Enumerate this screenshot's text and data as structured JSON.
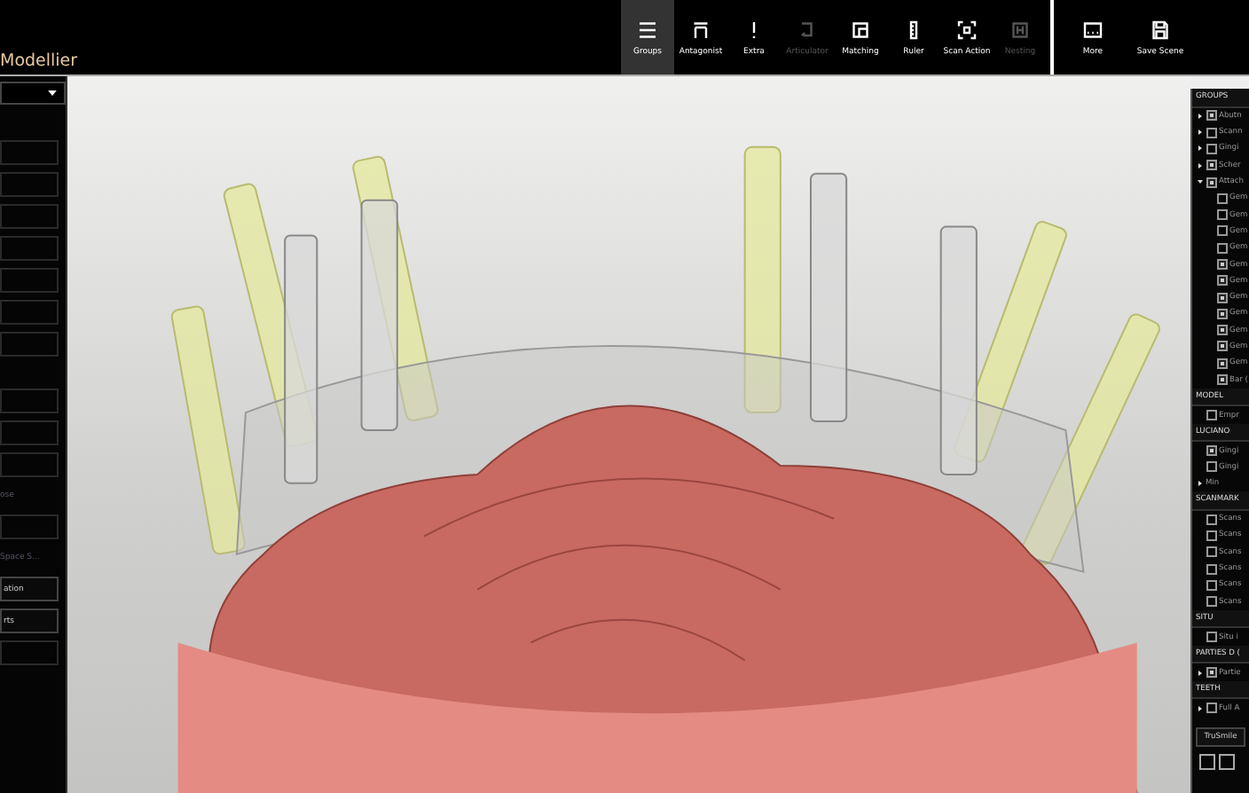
{
  "app": {
    "title": "Modellier"
  },
  "toolbar": [
    {
      "kind": "menu",
      "label": "Groups",
      "selected": true,
      "disabled": false
    },
    {
      "kind": "antagonist",
      "label": "Antagonist",
      "selected": false,
      "disabled": false
    },
    {
      "kind": "alert",
      "label": "Extra",
      "selected": false,
      "disabled": false
    },
    {
      "kind": "articulator",
      "label": "Articulator",
      "selected": false,
      "disabled": true
    },
    {
      "kind": "matching",
      "label": "Matching",
      "selected": false,
      "disabled": false
    },
    {
      "kind": "ruler",
      "label": "Ruler",
      "selected": false,
      "disabled": false
    },
    {
      "kind": "scan",
      "label": "Scan Action",
      "selected": false,
      "disabled": false
    },
    {
      "kind": "nesting",
      "label": "Nesting",
      "selected": false,
      "disabled": true
    }
  ],
  "toolbar_right": [
    {
      "kind": "more",
      "label": "More"
    },
    {
      "kind": "save",
      "label": "Save Scene"
    }
  ],
  "left_panel": {
    "rows": [
      {
        "kind": "field"
      },
      {
        "kind": "field"
      },
      {
        "kind": "field"
      },
      {
        "kind": "field"
      },
      {
        "kind": "field"
      },
      {
        "kind": "field"
      },
      {
        "kind": "field"
      },
      {
        "kind": "gap"
      },
      {
        "kind": "field"
      },
      {
        "kind": "field"
      },
      {
        "kind": "field"
      },
      {
        "kind": "text",
        "label": "ose"
      },
      {
        "kind": "field"
      },
      {
        "kind": "text",
        "label": "Space S..."
      },
      {
        "kind": "button",
        "label": "ation"
      },
      {
        "kind": "button",
        "label": "rts"
      },
      {
        "kind": "field"
      }
    ]
  },
  "groups_panel": {
    "sections": [
      {
        "title": "GROUPS",
        "items": [
          {
            "label": "Abutn",
            "checked": true,
            "expanded": false
          },
          {
            "label": "Scann",
            "checked": false,
            "expanded": false
          },
          {
            "label": "Gingi",
            "checked": false,
            "expanded": false
          },
          {
            "label": "Scher",
            "checked": true,
            "expanded": false
          },
          {
            "label": "Attach",
            "checked": true,
            "expanded": true,
            "children": [
              {
                "label": "Gem",
                "checked": false
              },
              {
                "label": "Gem",
                "checked": false
              },
              {
                "label": "Gem",
                "checked": false
              },
              {
                "label": "Gem",
                "checked": false
              },
              {
                "label": "Gem",
                "checked": true
              },
              {
                "label": "Gem",
                "checked": true
              },
              {
                "label": "Gem",
                "checked": true
              },
              {
                "label": "Gem",
                "checked": true
              },
              {
                "label": "Gem",
                "checked": true
              },
              {
                "label": "Gem",
                "checked": true
              },
              {
                "label": "Gem",
                "checked": true
              },
              {
                "label": "Bar (",
                "checked": true
              }
            ]
          }
        ]
      },
      {
        "title": "MODEL",
        "items": [
          {
            "label": "Empr",
            "checked": false
          }
        ]
      },
      {
        "title": "LUCIANO",
        "items": [
          {
            "label": "Gingi",
            "checked": true
          },
          {
            "label": "Gingi",
            "checked": false
          },
          {
            "label": "Min",
            "expanded": false
          }
        ]
      },
      {
        "title": "SCANMARK",
        "items": [
          {
            "label": "Scans",
            "checked": false
          },
          {
            "label": "Scans",
            "checked": false
          },
          {
            "label": "Scans",
            "checked": false
          },
          {
            "label": "Scans",
            "checked": false
          },
          {
            "label": "Scans",
            "checked": false
          },
          {
            "label": "Scans",
            "checked": false
          }
        ]
      },
      {
        "title": "SITU",
        "items": [
          {
            "label": "Situ i",
            "checked": false
          }
        ]
      },
      {
        "title": "PARTIES D (",
        "items": [
          {
            "label": "Partie",
            "checked": true,
            "expanded": false
          }
        ]
      },
      {
        "title": "TEETH",
        "items": [
          {
            "label": "Full A",
            "checked": false,
            "expanded": false
          }
        ]
      }
    ],
    "button": "TruSmile"
  }
}
